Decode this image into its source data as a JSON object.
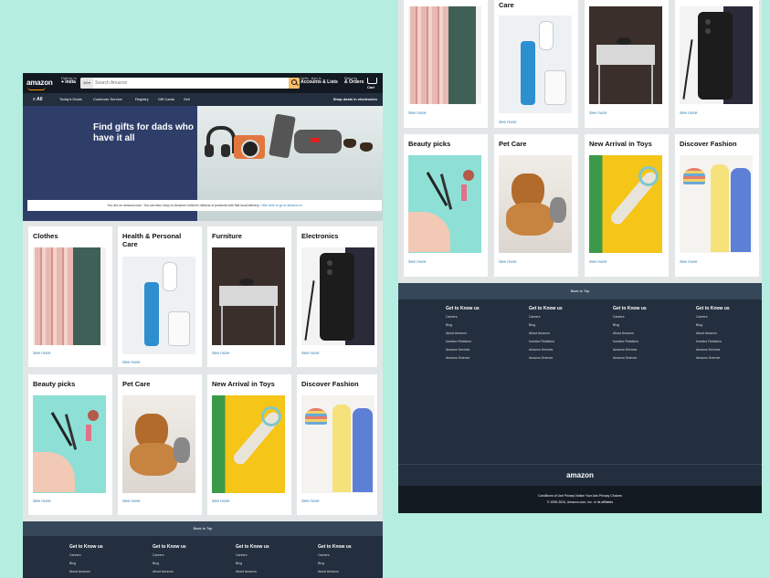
{
  "nav": {
    "logo": "amazon",
    "deliver_line1": "Deliver to",
    "deliver_line2": "India",
    "search_category": "All",
    "search_placeholder": "Search Amazon",
    "account_line1": "Hello, sign in",
    "account_line2": "Accounts & Lists",
    "returns_line1": "Returns",
    "returns_line2": "& Orders",
    "cart_label": "Cart"
  },
  "subnav": {
    "all": "≡ All",
    "items": [
      "Today's Deals",
      "Customer Service",
      "Registry",
      "Gift Cards",
      "Sell"
    ],
    "promo": "Shop deals in electronics"
  },
  "hero": {
    "headline": "Find gifts for dads who have it all",
    "notice": "You are on amazon.com. You can also shop on Amazon India for millions of products with fast local delivery.",
    "notice_link": "Click here to go to amazon.in"
  },
  "cards_row1": [
    {
      "title": "Clothes",
      "link": "See more"
    },
    {
      "title": "Health & Personal Care",
      "link": "See more"
    },
    {
      "title": "Furniture",
      "link": "See more"
    },
    {
      "title": "Electronics",
      "link": "See more"
    }
  ],
  "cards_row2": [
    {
      "title": "Beauty picks",
      "link": "See more"
    },
    {
      "title": "Pet Care",
      "link": "See more"
    },
    {
      "title": "New Arrival in Toys",
      "link": "See more"
    },
    {
      "title": "Discover Fashion",
      "link": "See more"
    }
  ],
  "top_partial_title": "Care",
  "back_to_top": "Back to Top",
  "footer_columns": [
    {
      "heading": "Get to Know us",
      "links": [
        "Careers",
        "Blog",
        "About Amazon",
        "Investor Relations",
        "Amazon Devices",
        "Amazon Science"
      ]
    },
    {
      "heading": "Get to Know us",
      "links": [
        "Careers",
        "Blog",
        "About Amazon",
        "Investor Relations",
        "Amazon Devices",
        "Amazon Science"
      ]
    },
    {
      "heading": "Get to Know us",
      "links": [
        "Careers",
        "Blog",
        "About Amazon",
        "Investor Relations",
        "Amazon Devices",
        "Amazon Science"
      ]
    },
    {
      "heading": "Get to Know us",
      "links": [
        "Careers",
        "Blog",
        "About Amazon",
        "Investor Relations",
        "Amazon Devices",
        "Amazon Science"
      ]
    }
  ],
  "footer_logo": "amazon",
  "footer_links": "Conditions of Use Privacy Notice Your Ads Privacy Choices",
  "copyright": "© 1996-2024, Amazon.com, Inc. or its affiliates",
  "colors": {
    "nav": "#131921",
    "subnav": "#232f3e",
    "accent": "#febd69",
    "link": "#2e7cb0",
    "background": "#b5ede1"
  }
}
